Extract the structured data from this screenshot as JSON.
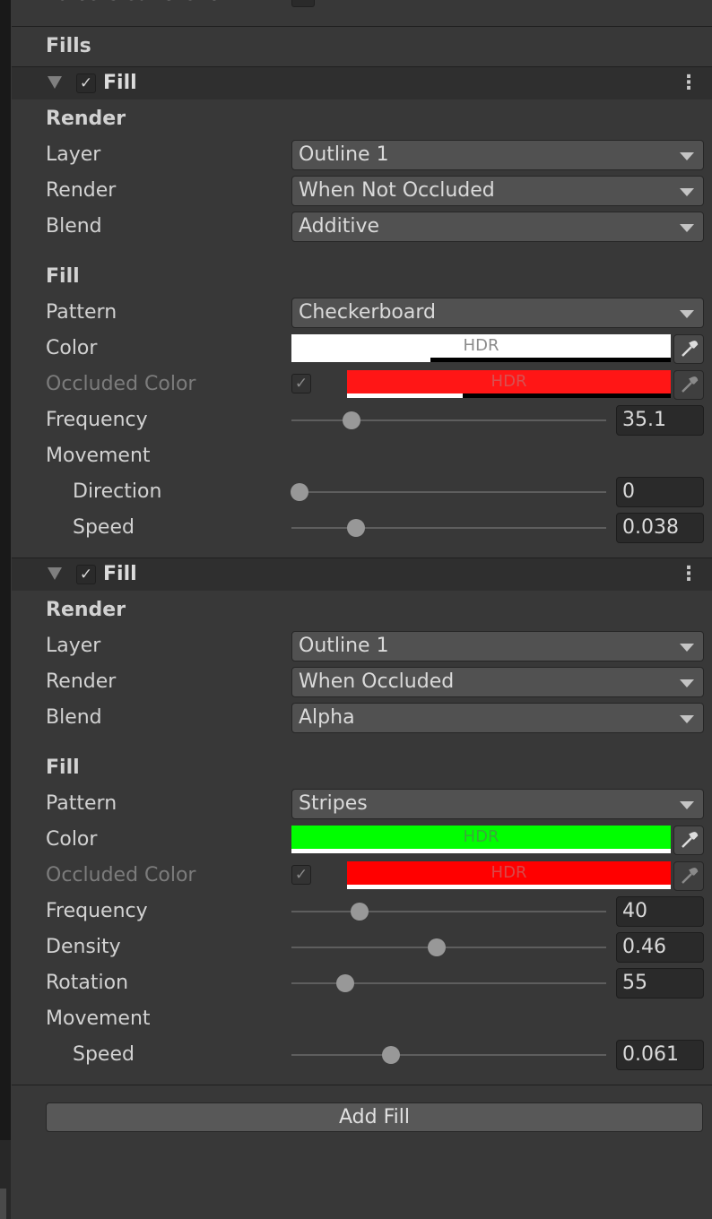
{
  "top": {
    "cut_label": "Force Clear Stencil"
  },
  "fills_heading": "Fills",
  "fill1": {
    "title": "Fill",
    "render_heading": "Render",
    "layer": {
      "label": "Layer",
      "value": "Outline 1"
    },
    "render": {
      "label": "Render",
      "value": "When Not Occluded"
    },
    "blend": {
      "label": "Blend",
      "value": "Additive"
    },
    "fill_heading": "Fill",
    "pattern": {
      "label": "Pattern",
      "value": "Checkerboard"
    },
    "color": {
      "label": "Color",
      "hdr": "HDR",
      "swatch": "#ffffff"
    },
    "occluded_color": {
      "label": "Occluded Color",
      "hdr": "HDR",
      "swatch": "#ff1616"
    },
    "frequency": {
      "label": "Frequency",
      "value": "35.1"
    },
    "movement": {
      "label": "Movement"
    },
    "direction": {
      "label": "Direction",
      "value": "0"
    },
    "speed": {
      "label": "Speed",
      "value": "0.038"
    }
  },
  "fill2": {
    "title": "Fill",
    "render_heading": "Render",
    "layer": {
      "label": "Layer",
      "value": "Outline 1"
    },
    "render": {
      "label": "Render",
      "value": "When Occluded"
    },
    "blend": {
      "label": "Blend",
      "value": "Alpha"
    },
    "fill_heading": "Fill",
    "pattern": {
      "label": "Pattern",
      "value": "Stripes"
    },
    "color": {
      "label": "Color",
      "hdr": "HDR",
      "swatch": "#00ff00"
    },
    "occluded_color": {
      "label": "Occluded Color",
      "hdr": "HDR",
      "swatch": "#ff0000"
    },
    "frequency": {
      "label": "Frequency",
      "value": "40"
    },
    "density": {
      "label": "Density",
      "value": "0.46"
    },
    "rotation": {
      "label": "Rotation",
      "value": "55"
    },
    "movement": {
      "label": "Movement"
    },
    "speed": {
      "label": "Speed",
      "value": "0.061"
    }
  },
  "add_fill_label": "Add Fill",
  "icons": {
    "fold": "triangle-down-icon",
    "check": "check-icon",
    "menu": "kebab-menu-icon",
    "picker": "eyedropper-icon"
  }
}
